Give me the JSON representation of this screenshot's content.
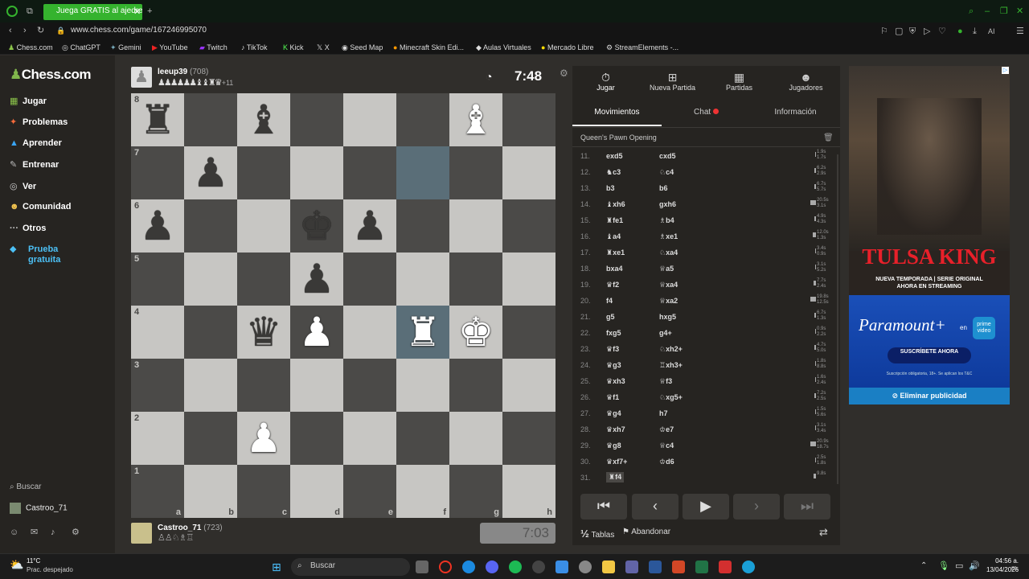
{
  "browser": {
    "tab_title": "Juega GRATIS al ajedrez c",
    "url": "www.chess.com/game/167246995070",
    "bookmarks": [
      "Chess.com",
      "ChatGPT",
      "Gemini",
      "YouTube",
      "Twitch",
      "TikTok",
      "Kick",
      "X",
      "Seed Map",
      "Minecraft Skin Edi...",
      "Aulas Virtuales",
      "Mercado Libre",
      "StreamElements -..."
    ],
    "ai_label": "AI"
  },
  "sidebar": {
    "logo": "Chess.com",
    "items": [
      {
        "label": "Jugar",
        "icon": "play-icon"
      },
      {
        "label": "Problemas",
        "icon": "puzzle-icon"
      },
      {
        "label": "Aprender",
        "icon": "learn-icon"
      },
      {
        "label": "Entrenar",
        "icon": "train-icon"
      },
      {
        "label": "Ver",
        "icon": "watch-icon"
      },
      {
        "label": "Comunidad",
        "icon": "community-icon"
      },
      {
        "label": "Otros",
        "icon": "more-icon"
      },
      {
        "label": "Prueba gratuita",
        "icon": "diamond-icon"
      }
    ],
    "search_label": "Buscar",
    "user": "Castroo_71"
  },
  "top_player": {
    "name": "leeup39",
    "rating": "(708)",
    "captured": "♟♟♟♟♟♟♝♝♜♛",
    "advantage": "+11",
    "clock": "7:48"
  },
  "bottom_player": {
    "name": "Castroo_71",
    "rating": "(723)",
    "captured": "♙♙♘♗♖",
    "clock": "7:03"
  },
  "board": {
    "ranks": [
      "8",
      "7",
      "6",
      "5",
      "4",
      "3",
      "2",
      "1"
    ],
    "files": [
      "a",
      "b",
      "c",
      "d",
      "e",
      "f",
      "g",
      "h"
    ],
    "highlights": [
      "f7",
      "f4"
    ],
    "pieces": [
      {
        "sq": "a8",
        "glyph": "♜",
        "color": "black"
      },
      {
        "sq": "c8",
        "glyph": "♝",
        "color": "black"
      },
      {
        "sq": "g8",
        "glyph": "♝",
        "color": "white"
      },
      {
        "sq": "b7",
        "glyph": "♟",
        "color": "black"
      },
      {
        "sq": "a6",
        "glyph": "♟",
        "color": "black"
      },
      {
        "sq": "d6",
        "glyph": "♚",
        "color": "black"
      },
      {
        "sq": "e6",
        "glyph": "♟",
        "color": "black"
      },
      {
        "sq": "d5",
        "glyph": "♟",
        "color": "black"
      },
      {
        "sq": "c4",
        "glyph": "♛",
        "color": "black"
      },
      {
        "sq": "d4",
        "glyph": "♟",
        "color": "white"
      },
      {
        "sq": "f4",
        "glyph": "♜",
        "color": "white"
      },
      {
        "sq": "g4",
        "glyph": "♚",
        "color": "white"
      },
      {
        "sq": "c2",
        "glyph": "♟",
        "color": "white"
      }
    ]
  },
  "panel": {
    "top_tabs": [
      {
        "label": "Jugar",
        "icon": "stopwatch-icon"
      },
      {
        "label": "Nueva Partida",
        "icon": "plus-icon"
      },
      {
        "label": "Partidas",
        "icon": "board-icon"
      },
      {
        "label": "Jugadores",
        "icon": "players-icon"
      }
    ],
    "tabs": [
      "Movimientos",
      "Chat",
      "Información"
    ],
    "opening": "Queen's Pawn Opening",
    "moves": [
      {
        "n": "11.",
        "w": "exd5",
        "b": "cxd5",
        "t1": "1.9s",
        "t2": "1.7s"
      },
      {
        "n": "12.",
        "w": "♞c3",
        "b": "♘c4",
        "t1": "6.2s",
        "t2": "2.9s"
      },
      {
        "n": "13.",
        "w": "b3",
        "b": "b6",
        "t1": "6.7s",
        "t2": "5.7s"
      },
      {
        "n": "14.",
        "w": "♝xh6",
        "b": "gxh6",
        "t1": "20.5s",
        "t2": "3.1s"
      },
      {
        "n": "15.",
        "w": "♜fe1",
        "b": "♗b4",
        "t1": "4.9s",
        "t2": "4.3s"
      },
      {
        "n": "16.",
        "w": "♝a4",
        "b": "♗xe1",
        "t1": "12.0s",
        "t2": "1.3s"
      },
      {
        "n": "17.",
        "w": "♜xe1",
        "b": "♘xa4",
        "t1": "3.4s",
        "t2": "0.9s"
      },
      {
        "n": "18.",
        "w": "bxa4",
        "b": "♕a5",
        "t1": "3.1s",
        "t2": "5.2s"
      },
      {
        "n": "19.",
        "w": "♛f2",
        "b": "♕xa4",
        "t1": "7.7s",
        "t2": "2.4s"
      },
      {
        "n": "20.",
        "w": "f4",
        "b": "♕xa2",
        "t1": "19.8s",
        "t2": "12.5s"
      },
      {
        "n": "21.",
        "w": "g5",
        "b": "hxg5",
        "t1": "6.7s",
        "t2": "1.3s"
      },
      {
        "n": "22.",
        "w": "fxg5",
        "b": "g4+",
        "t1": "0.9s",
        "t2": "2.2s"
      },
      {
        "n": "23.",
        "w": "♛f3",
        "b": "♘xh2+",
        "t1": "4.7s",
        "t2": "5.0s"
      },
      {
        "n": "24.",
        "w": "♛g3",
        "b": "♖xh3+",
        "t1": "1.8s",
        "t2": "8.8s"
      },
      {
        "n": "25.",
        "w": "♛xh3",
        "b": "♕f3",
        "t1": "1.6s",
        "t2": "2.4s"
      },
      {
        "n": "26.",
        "w": "♛f1",
        "b": "♘xg5+",
        "t1": "7.2s",
        "t2": "2.5s"
      },
      {
        "n": "27.",
        "w": "♛g4",
        "b": "h7",
        "t1": "1.5s",
        "t2": "5.6s"
      },
      {
        "n": "28.",
        "w": "♛xh7",
        "b": "♔e7",
        "t1": "3.1s",
        "t2": "3.4s"
      },
      {
        "n": "29.",
        "w": "♛g8",
        "b": "♕c4",
        "t1": "20.9s",
        "t2": "18.7s"
      },
      {
        "n": "30.",
        "w": "♛xf7+",
        "b": "♔d6",
        "t1": "2.5s",
        "t2": "1.8s"
      },
      {
        "n": "31.",
        "w": "♜f4",
        "b": "",
        "t1": "9.8s",
        "t2": ""
      }
    ],
    "footer_tablas": "Tablas",
    "footer_abandonar": "Abandonar"
  },
  "ad": {
    "title": "TULSA KING",
    "line1": "NUEVA TEMPORADA | SERIE ORIGINAL",
    "line2": "AHORA EN STREAMING",
    "brand": "Paramount+",
    "en": "en",
    "prime": "prime video",
    "cta": "SUSCRÍBETE AHORA",
    "fine": "Suscripción obligatoria, 18+. Se aplican los T&C",
    "remove": "Eliminar publicidad"
  },
  "taskbar": {
    "temp": "11°C",
    "weather": "Prac. despejado",
    "search": "Buscar",
    "time": "04:56 a. m.",
    "date": "13/04/2026"
  }
}
